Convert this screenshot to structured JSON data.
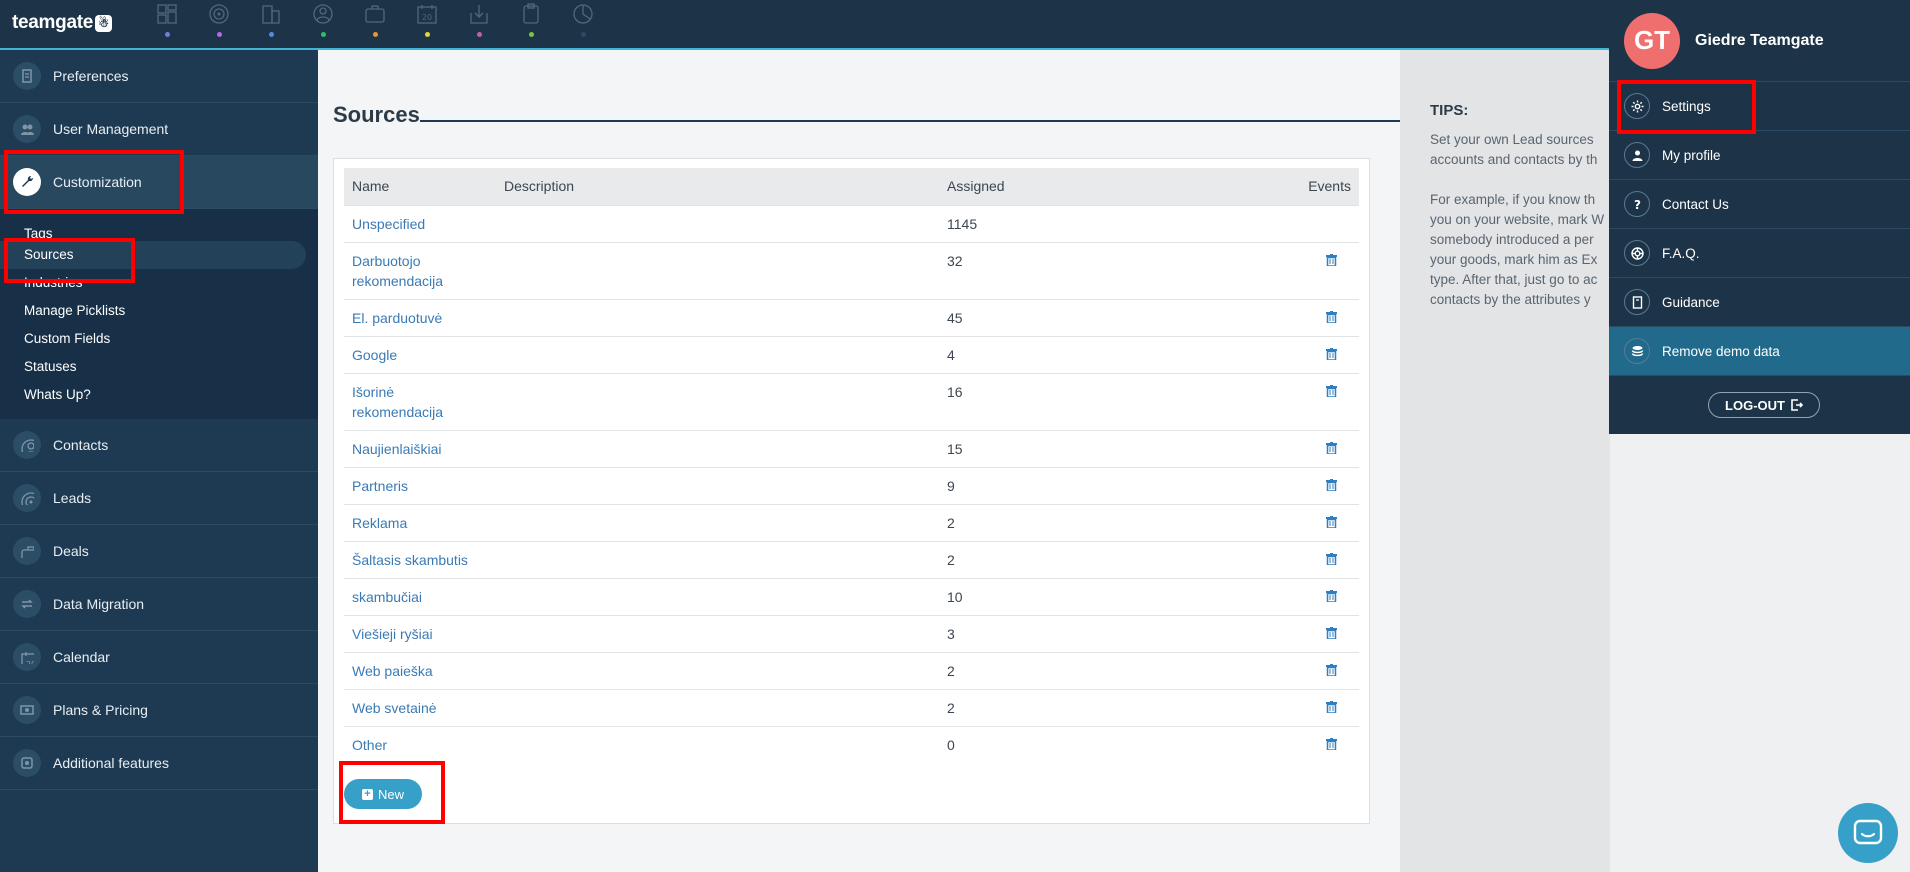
{
  "app": {
    "logo": "teamgate"
  },
  "topnav": {
    "icons": [
      {
        "name": "dashboard-icon",
        "color": "#6d7fd9"
      },
      {
        "name": "target-icon",
        "color": "#b06ce0"
      },
      {
        "name": "buildings-icon",
        "color": "#4f8fd9"
      },
      {
        "name": "person-icon",
        "color": "#2fbf6b"
      },
      {
        "name": "briefcase-icon",
        "color": "#e8943a"
      },
      {
        "name": "calendar-icon",
        "color": "#e0d63a",
        "label": "20"
      },
      {
        "name": "import-icon",
        "color": "#c05fb0"
      },
      {
        "name": "clipboard-icon",
        "color": "#7ec240"
      },
      {
        "name": "pie-chart-icon",
        "color": "#2a4a66"
      }
    ]
  },
  "sidebar": {
    "items": [
      {
        "label": "Preferences",
        "icon": "document-icon"
      },
      {
        "label": "User Management",
        "icon": "users-icon"
      },
      {
        "label": "Customization",
        "icon": "wrench-icon",
        "active": true
      },
      {
        "label": "Contacts",
        "icon": "person-icon"
      },
      {
        "label": "Leads",
        "icon": "target-icon"
      },
      {
        "label": "Deals",
        "icon": "briefcase-icon"
      },
      {
        "label": "Data Migration",
        "icon": "migration-icon"
      },
      {
        "label": "Calendar",
        "icon": "calendar-icon"
      },
      {
        "label": "Plans & Pricing",
        "icon": "money-icon"
      },
      {
        "label": "Additional features",
        "icon": "puzzle-icon"
      }
    ],
    "subitems": [
      "Tags",
      "Sources",
      "Industries",
      "Manage Picklists",
      "Custom Fields",
      "Statuses",
      "Whats Up?"
    ],
    "current_sub": "Sources"
  },
  "main": {
    "title": "Sources",
    "table": {
      "headers": {
        "name": "Name",
        "description": "Description",
        "assigned": "Assigned",
        "events": "Events"
      },
      "rows": [
        {
          "name": "Unspecified",
          "description": "",
          "assigned": "1145",
          "delete": false
        },
        {
          "name": "Darbuotojo rekomendacija",
          "description": "",
          "assigned": "32",
          "delete": true
        },
        {
          "name": "El. parduotuvė",
          "description": "",
          "assigned": "45",
          "delete": true
        },
        {
          "name": "Google",
          "description": "",
          "assigned": "4",
          "delete": true
        },
        {
          "name": "Išorinė rekomendacija",
          "description": "",
          "assigned": "16",
          "delete": true
        },
        {
          "name": "Naujienlaiškiai",
          "description": "",
          "assigned": "15",
          "delete": true
        },
        {
          "name": "Partneris",
          "description": "",
          "assigned": "9",
          "delete": true
        },
        {
          "name": "Reklama",
          "description": "",
          "assigned": "2",
          "delete": true
        },
        {
          "name": "Šaltasis skambutis",
          "description": "",
          "assigned": "2",
          "delete": true
        },
        {
          "name": "skambučiai",
          "description": "",
          "assigned": "10",
          "delete": true
        },
        {
          "name": "Viešieji ryšiai",
          "description": "",
          "assigned": "3",
          "delete": true
        },
        {
          "name": "Web paieška",
          "description": "",
          "assigned": "2",
          "delete": true
        },
        {
          "name": "Web svetainė",
          "description": "",
          "assigned": "2",
          "delete": true
        },
        {
          "name": "Other",
          "description": "",
          "assigned": "0",
          "delete": true
        }
      ]
    },
    "new_button": "New"
  },
  "tips": {
    "title": "TIPS:",
    "lines1": [
      "Set your own Lead sources",
      "accounts and contacts by th"
    ],
    "lines2": [
      "For example, if you know th",
      "you on your website, mark W",
      "somebody introduced a per",
      "your goods, mark him as Ex",
      "type. After that, just go to ac",
      "contacts by the attributes y"
    ]
  },
  "user_menu": {
    "initials": "GT",
    "name": "Giedre Teamgate",
    "items": [
      {
        "label": "Settings",
        "icon": "gear-icon"
      },
      {
        "label": "My profile",
        "icon": "profile-icon"
      },
      {
        "label": "Contact Us",
        "icon": "question-icon"
      },
      {
        "label": "F.A.Q.",
        "icon": "lifebuoy-icon"
      },
      {
        "label": "Guidance",
        "icon": "book-icon"
      },
      {
        "label": "Remove demo data",
        "icon": "database-icon",
        "highlight": true
      }
    ],
    "logout": "LOG-OUT"
  },
  "colors": {
    "brand_dark": "#1d3448",
    "accent": "#36a0c9",
    "link": "#3a7ab5",
    "annotation": "#ff0000"
  }
}
